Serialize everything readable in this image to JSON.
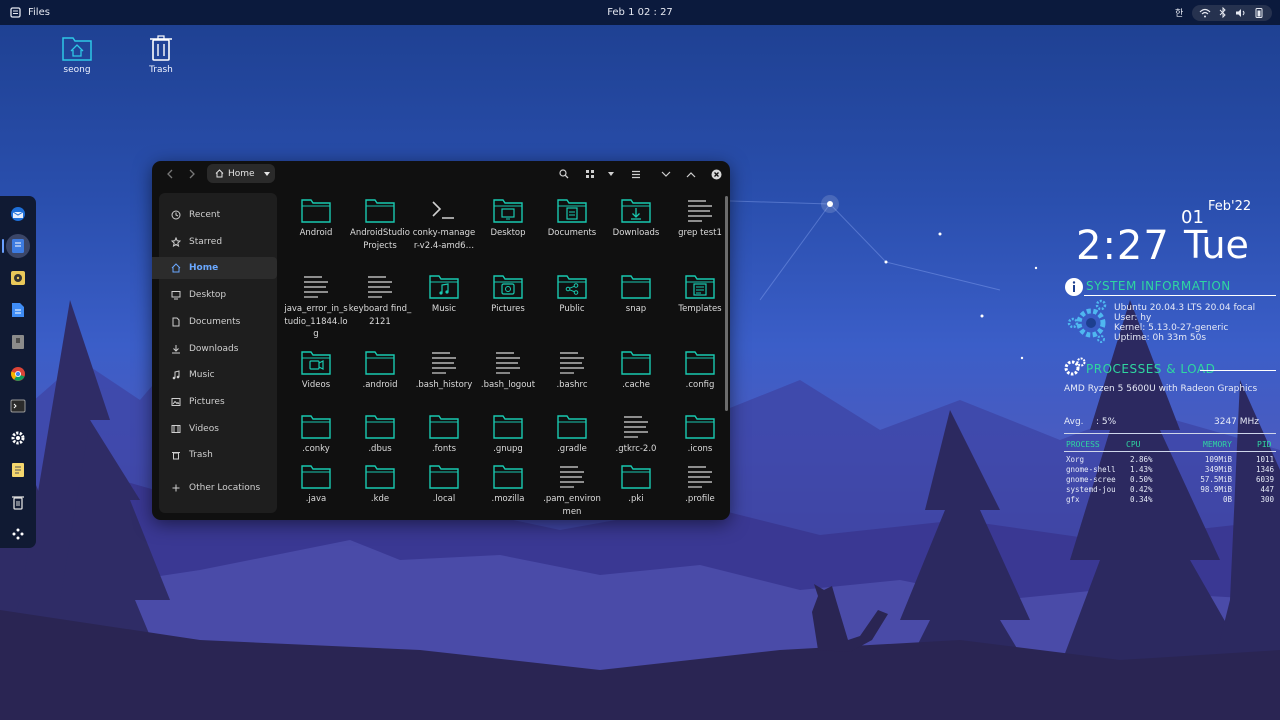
{
  "topbar": {
    "app_name": "Files",
    "datetime": "Feb 1  02 : 27"
  },
  "desktop": {
    "icons": [
      {
        "label": "seong",
        "icon": "home-folder-icon"
      },
      {
        "label": "Trash",
        "icon": "trash-icon"
      }
    ]
  },
  "dock": {
    "items": [
      "thunderbird-icon",
      "files-icon",
      "rhythmbox-icon",
      "docs-icon",
      "archive-icon",
      "chrome-icon",
      "terminal-icon",
      "settings-icon",
      "text-editor-icon",
      "trash-icon",
      "show-apps-icon"
    ]
  },
  "files": {
    "location": "Home",
    "sidebar": [
      {
        "label": "Recent",
        "icon": "clock-icon"
      },
      {
        "label": "Starred",
        "icon": "star-icon"
      },
      {
        "label": "Home",
        "icon": "home-icon",
        "active": true
      },
      {
        "label": "Desktop",
        "icon": "desktop-icon"
      },
      {
        "label": "Documents",
        "icon": "document-icon"
      },
      {
        "label": "Downloads",
        "icon": "download-icon"
      },
      {
        "label": "Music",
        "icon": "music-icon"
      },
      {
        "label": "Pictures",
        "icon": "picture-icon"
      },
      {
        "label": "Videos",
        "icon": "video-icon"
      },
      {
        "label": "Trash",
        "icon": "trash-icon"
      },
      {
        "label": "Other Locations",
        "icon": "plus-icon"
      }
    ],
    "items": [
      {
        "name": "Android",
        "type": "folder"
      },
      {
        "name": "AndroidStudioProjects",
        "type": "folder"
      },
      {
        "name": "conky-manager-v2.4-amd6…",
        "type": "script"
      },
      {
        "name": "Desktop",
        "type": "folder-desktop"
      },
      {
        "name": "Documents",
        "type": "folder-documents"
      },
      {
        "name": "Downloads",
        "type": "folder-downloads"
      },
      {
        "name": "grep test1",
        "type": "text"
      },
      {
        "name": "java_error_in_studio_11844.log",
        "type": "text"
      },
      {
        "name": "keyboard find_2121",
        "type": "text"
      },
      {
        "name": "Music",
        "type": "folder-music"
      },
      {
        "name": "Pictures",
        "type": "folder-pictures"
      },
      {
        "name": "Public",
        "type": "folder-public"
      },
      {
        "name": "snap",
        "type": "folder"
      },
      {
        "name": "Templates",
        "type": "folder-templates"
      },
      {
        "name": "Videos",
        "type": "folder-videos"
      },
      {
        "name": ".android",
        "type": "folder"
      },
      {
        "name": ".bash_history",
        "type": "text"
      },
      {
        "name": ".bash_logout",
        "type": "text"
      },
      {
        "name": ".bashrc",
        "type": "text"
      },
      {
        "name": ".cache",
        "type": "folder"
      },
      {
        "name": ".config",
        "type": "folder"
      },
      {
        "name": ".conky",
        "type": "folder"
      },
      {
        "name": ".dbus",
        "type": "folder"
      },
      {
        "name": ".fonts",
        "type": "folder"
      },
      {
        "name": ".gnupg",
        "type": "folder"
      },
      {
        "name": ".gradle",
        "type": "folder"
      },
      {
        "name": ".gtkrc-2.0",
        "type": "text"
      },
      {
        "name": ".icons",
        "type": "folder"
      },
      {
        "name": ".java",
        "type": "folder"
      },
      {
        "name": ".kde",
        "type": "folder"
      },
      {
        "name": ".local",
        "type": "folder"
      },
      {
        "name": ".mozilla",
        "type": "folder"
      },
      {
        "name": ".pam_environmen",
        "type": "text"
      },
      {
        "name": ".pki",
        "type": "folder"
      },
      {
        "name": ".profile",
        "type": "text"
      }
    ]
  },
  "conky": {
    "month": "Feb'22",
    "day_num": "01",
    "time": "2:27",
    "weekday": "Tue",
    "sysinfo_title": "SYSTEM INFORMATION",
    "os": "Ubuntu 20.04.3 LTS 20.04 focal",
    "user": "User: hy",
    "kernel": "Kernel: 5.13.0-27-generic",
    "uptime": "Uptime: 0h 33m 50s",
    "proc_title": "PROCESSES & LOAD",
    "cpu_name": "AMD Ryzen 5 5600U with Radeon Graphics",
    "avg_label": "Avg.",
    "avg_value": ":  5%",
    "freq": "3247 MHz",
    "headers": {
      "process": "PROCESS",
      "cpu": "CPU",
      "memory": "MEMORY",
      "pid": "PID"
    },
    "processes": [
      {
        "name": "Xorg",
        "cpu": "2.86%",
        "mem": "109MiB",
        "pid": "1011"
      },
      {
        "name": "gnome-shell",
        "cpu": "1.43%",
        "mem": "349MiB",
        "pid": "1346"
      },
      {
        "name": "gnome-scree",
        "cpu": "0.50%",
        "mem": "57.5MiB",
        "pid": "6039"
      },
      {
        "name": "systemd-jou",
        "cpu": "0.42%",
        "mem": "98.9MiB",
        "pid": "447"
      },
      {
        "name": "gfx",
        "cpu": "0.34%",
        "mem": "0B",
        "pid": "300"
      }
    ]
  },
  "colors": {
    "accent": "#2fd6a0",
    "folder_teal": "#19c9b0",
    "link_blue": "#6aa8ff"
  }
}
